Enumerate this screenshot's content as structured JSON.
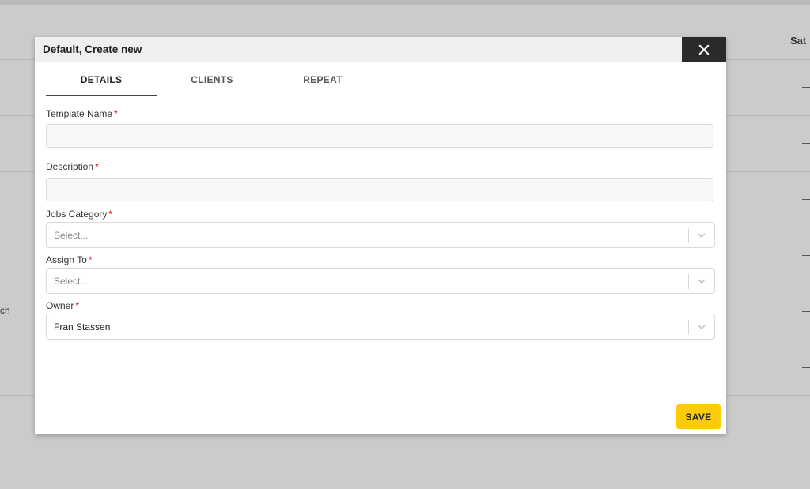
{
  "background": {
    "header_last_day": "Sat",
    "row_text_fragment": "ch"
  },
  "modal": {
    "title": "Default, Create new",
    "close_icon": "close-icon",
    "tabs": [
      {
        "label": "DETAILS",
        "active": true
      },
      {
        "label": "CLIENTS",
        "active": false
      },
      {
        "label": "REPEAT",
        "active": false
      }
    ],
    "fields": {
      "template_name": {
        "label": "Template Name",
        "required_mark": "*",
        "value": ""
      },
      "description": {
        "label": "Description",
        "required_mark": "*",
        "value": ""
      },
      "jobs_category": {
        "label": "Jobs Category",
        "required_mark": "*",
        "value": "Select..."
      },
      "assign_to": {
        "label": "Assign To",
        "required_mark": "*",
        "value": "Select..."
      },
      "owner": {
        "label": "Owner",
        "required_mark": "*",
        "value": "Fran Stassen"
      }
    },
    "save_label": "SAVE"
  },
  "colors": {
    "accent": "#fbcb0a",
    "required": "#e00000",
    "close_bg": "#2a2a2a"
  }
}
